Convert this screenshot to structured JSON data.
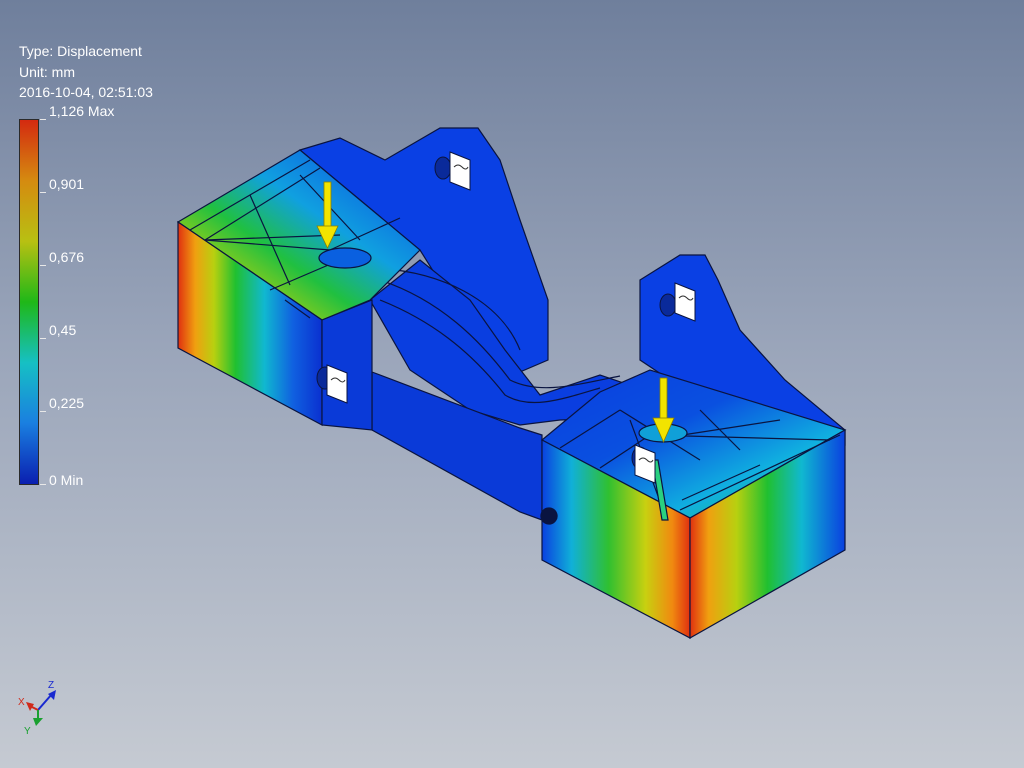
{
  "legend": {
    "type_label": "Type: Displacement",
    "unit_label": "Unit: mm",
    "timestamp": "2016-10-04, 02:51:03",
    "ticks": [
      "1,126 Max",
      "0,901",
      "0,676",
      "0,45",
      "0,225",
      "0 Min"
    ],
    "colors": [
      "#d42a10",
      "#d58b10",
      "#b8c012",
      "#1fb818",
      "#16c0c4",
      "#1a7fe0",
      "#0a1fb0"
    ]
  },
  "triad": {
    "x_label": "X",
    "y_label": "Y",
    "z_label": "Z"
  },
  "theme": {
    "load_arrow": "#f2e400",
    "mesh_base": "#0a3ee0",
    "edge": "#0a1440"
  }
}
